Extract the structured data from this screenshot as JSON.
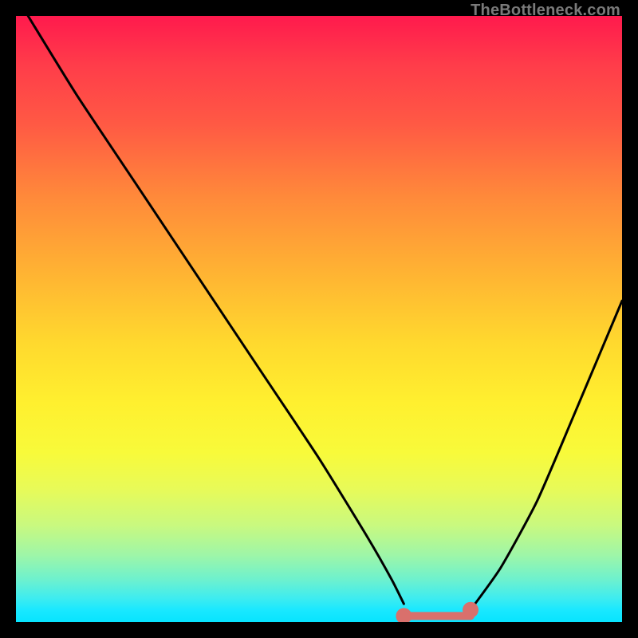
{
  "watermark": "TheBottleneck.com",
  "chart_data": {
    "type": "line",
    "title": "",
    "xlabel": "",
    "ylabel": "",
    "xlim": [
      0,
      100
    ],
    "ylim": [
      0,
      100
    ],
    "grid": false,
    "annotations": [],
    "series": [
      {
        "name": "curve",
        "x": [
          2,
          10,
          20,
          30,
          40,
          50,
          58,
          62,
          64,
          67,
          70,
          73,
          75,
          80,
          86,
          92,
          100
        ],
        "values": [
          100,
          87,
          72,
          57,
          42,
          27,
          14,
          7,
          3,
          1,
          1,
          1,
          2,
          9,
          20,
          34,
          53
        ]
      }
    ],
    "markers": [
      {
        "name": "left-cap",
        "x": 64,
        "y": 1
      },
      {
        "name": "right-cap",
        "x": 75,
        "y": 2
      }
    ],
    "flat_segment": {
      "x_start": 64,
      "x_end": 75,
      "y": 1
    },
    "colors": {
      "curve": "#000000",
      "flat_segment": "#d9706c",
      "marker": "#d9706c",
      "gradient_top": "#ff1a4d",
      "gradient_bottom": "#07e4ff"
    }
  }
}
